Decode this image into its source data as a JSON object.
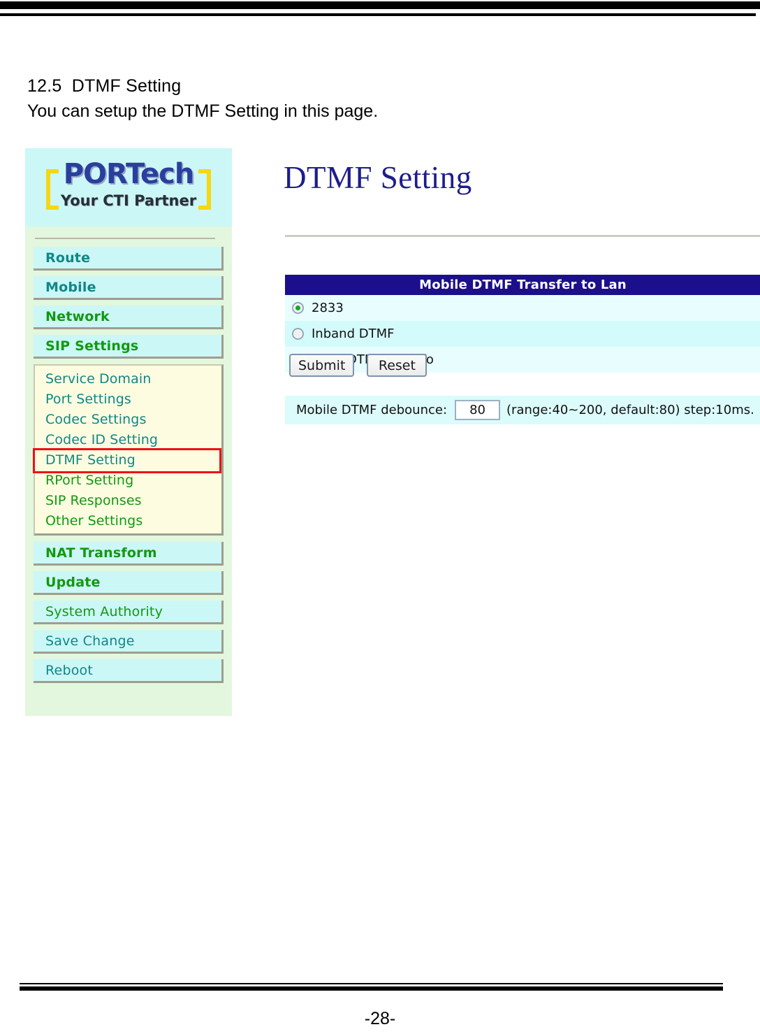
{
  "document": {
    "heading": "12.5  DTMF Setting",
    "subheading": "You can setup the DTMF Setting in this page.",
    "page_number": "-28-"
  },
  "logo": {
    "brand": "PORTech",
    "tagline": "Your CTI Partner",
    "brand_color": "#2a3f9d",
    "bracket_color": "#f5d714"
  },
  "sidebar": {
    "items": [
      {
        "label": "Route",
        "color": "teal",
        "bold": true
      },
      {
        "label": "Mobile",
        "color": "teal",
        "bold": true
      },
      {
        "label": "Network",
        "color": "green",
        "bold": true
      },
      {
        "label": "SIP Settings",
        "color": "green",
        "bold": true
      }
    ],
    "submenu": [
      {
        "label": "Service Domain",
        "color": "teal",
        "highlighted": false
      },
      {
        "label": "Port Settings",
        "color": "teal",
        "highlighted": false
      },
      {
        "label": "Codec Settings",
        "color": "teal",
        "highlighted": false
      },
      {
        "label": "Codec ID Setting",
        "color": "teal",
        "highlighted": false
      },
      {
        "label": "DTMF Setting",
        "color": "teal",
        "highlighted": true
      },
      {
        "label": "RPort Setting",
        "color": "green",
        "highlighted": false
      },
      {
        "label": "SIP Responses",
        "color": "green",
        "highlighted": false
      },
      {
        "label": "Other Settings",
        "color": "green",
        "highlighted": false
      }
    ],
    "items_bottom": [
      {
        "label": "NAT Transform",
        "color": "green",
        "bold": true
      },
      {
        "label": "Update",
        "color": "green",
        "bold": true
      },
      {
        "label": "System Authority",
        "color": "green",
        "bold": false
      },
      {
        "label": "Save Change",
        "color": "teal",
        "bold": false
      },
      {
        "label": "Reboot",
        "color": "teal",
        "bold": false
      }
    ],
    "highlight_color": "#ee1111"
  },
  "main": {
    "title": "DTMF Setting",
    "title_color": "#1d1d8c",
    "table": {
      "header": "Mobile DTMF Transfer to Lan",
      "header_bg": "#1c0f8c",
      "options": [
        {
          "label": "2833",
          "selected": true
        },
        {
          "label": "Inband DTMF",
          "selected": false
        },
        {
          "label": "Send DTMF SIP Info",
          "selected": false
        }
      ],
      "debounce": {
        "label": "Mobile DTMF debounce:",
        "value": "80",
        "hint": "(range:40~200, default:80) step:10ms."
      }
    },
    "buttons": {
      "submit": "Submit",
      "reset": "Reset"
    }
  }
}
